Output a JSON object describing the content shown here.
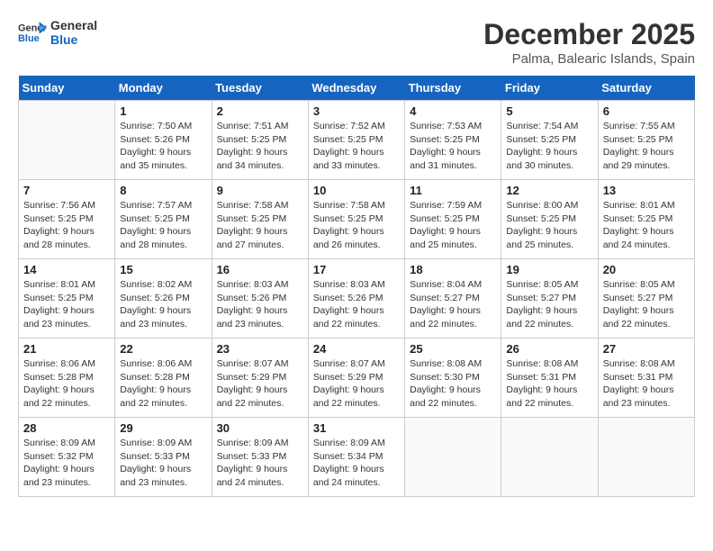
{
  "header": {
    "logo_general": "General",
    "logo_blue": "Blue",
    "month_year": "December 2025",
    "location": "Palma, Balearic Islands, Spain"
  },
  "days_of_week": [
    "Sunday",
    "Monday",
    "Tuesday",
    "Wednesday",
    "Thursday",
    "Friday",
    "Saturday"
  ],
  "weeks": [
    [
      {
        "day": "",
        "sunrise": "",
        "sunset": "",
        "daylight": ""
      },
      {
        "day": "1",
        "sunrise": "Sunrise: 7:50 AM",
        "sunset": "Sunset: 5:26 PM",
        "daylight": "Daylight: 9 hours and 35 minutes."
      },
      {
        "day": "2",
        "sunrise": "Sunrise: 7:51 AM",
        "sunset": "Sunset: 5:25 PM",
        "daylight": "Daylight: 9 hours and 34 minutes."
      },
      {
        "day": "3",
        "sunrise": "Sunrise: 7:52 AM",
        "sunset": "Sunset: 5:25 PM",
        "daylight": "Daylight: 9 hours and 33 minutes."
      },
      {
        "day": "4",
        "sunrise": "Sunrise: 7:53 AM",
        "sunset": "Sunset: 5:25 PM",
        "daylight": "Daylight: 9 hours and 31 minutes."
      },
      {
        "day": "5",
        "sunrise": "Sunrise: 7:54 AM",
        "sunset": "Sunset: 5:25 PM",
        "daylight": "Daylight: 9 hours and 30 minutes."
      },
      {
        "day": "6",
        "sunrise": "Sunrise: 7:55 AM",
        "sunset": "Sunset: 5:25 PM",
        "daylight": "Daylight: 9 hours and 29 minutes."
      }
    ],
    [
      {
        "day": "7",
        "sunrise": "Sunrise: 7:56 AM",
        "sunset": "Sunset: 5:25 PM",
        "daylight": "Daylight: 9 hours and 28 minutes."
      },
      {
        "day": "8",
        "sunrise": "Sunrise: 7:57 AM",
        "sunset": "Sunset: 5:25 PM",
        "daylight": "Daylight: 9 hours and 28 minutes."
      },
      {
        "day": "9",
        "sunrise": "Sunrise: 7:58 AM",
        "sunset": "Sunset: 5:25 PM",
        "daylight": "Daylight: 9 hours and 27 minutes."
      },
      {
        "day": "10",
        "sunrise": "Sunrise: 7:58 AM",
        "sunset": "Sunset: 5:25 PM",
        "daylight": "Daylight: 9 hours and 26 minutes."
      },
      {
        "day": "11",
        "sunrise": "Sunrise: 7:59 AM",
        "sunset": "Sunset: 5:25 PM",
        "daylight": "Daylight: 9 hours and 25 minutes."
      },
      {
        "day": "12",
        "sunrise": "Sunrise: 8:00 AM",
        "sunset": "Sunset: 5:25 PM",
        "daylight": "Daylight: 9 hours and 25 minutes."
      },
      {
        "day": "13",
        "sunrise": "Sunrise: 8:01 AM",
        "sunset": "Sunset: 5:25 PM",
        "daylight": "Daylight: 9 hours and 24 minutes."
      }
    ],
    [
      {
        "day": "14",
        "sunrise": "Sunrise: 8:01 AM",
        "sunset": "Sunset: 5:25 PM",
        "daylight": "Daylight: 9 hours and 23 minutes."
      },
      {
        "day": "15",
        "sunrise": "Sunrise: 8:02 AM",
        "sunset": "Sunset: 5:26 PM",
        "daylight": "Daylight: 9 hours and 23 minutes."
      },
      {
        "day": "16",
        "sunrise": "Sunrise: 8:03 AM",
        "sunset": "Sunset: 5:26 PM",
        "daylight": "Daylight: 9 hours and 23 minutes."
      },
      {
        "day": "17",
        "sunrise": "Sunrise: 8:03 AM",
        "sunset": "Sunset: 5:26 PM",
        "daylight": "Daylight: 9 hours and 22 minutes."
      },
      {
        "day": "18",
        "sunrise": "Sunrise: 8:04 AM",
        "sunset": "Sunset: 5:27 PM",
        "daylight": "Daylight: 9 hours and 22 minutes."
      },
      {
        "day": "19",
        "sunrise": "Sunrise: 8:05 AM",
        "sunset": "Sunset: 5:27 PM",
        "daylight": "Daylight: 9 hours and 22 minutes."
      },
      {
        "day": "20",
        "sunrise": "Sunrise: 8:05 AM",
        "sunset": "Sunset: 5:27 PM",
        "daylight": "Daylight: 9 hours and 22 minutes."
      }
    ],
    [
      {
        "day": "21",
        "sunrise": "Sunrise: 8:06 AM",
        "sunset": "Sunset: 5:28 PM",
        "daylight": "Daylight: 9 hours and 22 minutes."
      },
      {
        "day": "22",
        "sunrise": "Sunrise: 8:06 AM",
        "sunset": "Sunset: 5:28 PM",
        "daylight": "Daylight: 9 hours and 22 minutes."
      },
      {
        "day": "23",
        "sunrise": "Sunrise: 8:07 AM",
        "sunset": "Sunset: 5:29 PM",
        "daylight": "Daylight: 9 hours and 22 minutes."
      },
      {
        "day": "24",
        "sunrise": "Sunrise: 8:07 AM",
        "sunset": "Sunset: 5:29 PM",
        "daylight": "Daylight: 9 hours and 22 minutes."
      },
      {
        "day": "25",
        "sunrise": "Sunrise: 8:08 AM",
        "sunset": "Sunset: 5:30 PM",
        "daylight": "Daylight: 9 hours and 22 minutes."
      },
      {
        "day": "26",
        "sunrise": "Sunrise: 8:08 AM",
        "sunset": "Sunset: 5:31 PM",
        "daylight": "Daylight: 9 hours and 22 minutes."
      },
      {
        "day": "27",
        "sunrise": "Sunrise: 8:08 AM",
        "sunset": "Sunset: 5:31 PM",
        "daylight": "Daylight: 9 hours and 23 minutes."
      }
    ],
    [
      {
        "day": "28",
        "sunrise": "Sunrise: 8:09 AM",
        "sunset": "Sunset: 5:32 PM",
        "daylight": "Daylight: 9 hours and 23 minutes."
      },
      {
        "day": "29",
        "sunrise": "Sunrise: 8:09 AM",
        "sunset": "Sunset: 5:33 PM",
        "daylight": "Daylight: 9 hours and 23 minutes."
      },
      {
        "day": "30",
        "sunrise": "Sunrise: 8:09 AM",
        "sunset": "Sunset: 5:33 PM",
        "daylight": "Daylight: 9 hours and 24 minutes."
      },
      {
        "day": "31",
        "sunrise": "Sunrise: 8:09 AM",
        "sunset": "Sunset: 5:34 PM",
        "daylight": "Daylight: 9 hours and 24 minutes."
      },
      {
        "day": "",
        "sunrise": "",
        "sunset": "",
        "daylight": ""
      },
      {
        "day": "",
        "sunrise": "",
        "sunset": "",
        "daylight": ""
      },
      {
        "day": "",
        "sunrise": "",
        "sunset": "",
        "daylight": ""
      }
    ]
  ]
}
